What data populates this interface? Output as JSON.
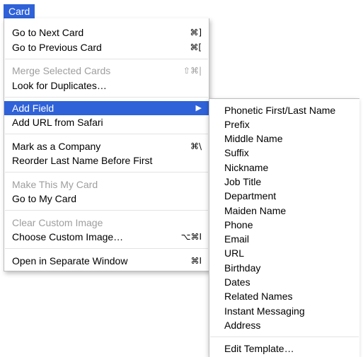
{
  "menubar": {
    "title": "Card"
  },
  "card_menu": {
    "items": [
      {
        "label": "Go to Next Card",
        "shortcut": "⌘]"
      },
      {
        "label": "Go to Previous Card",
        "shortcut": "⌘["
      },
      {
        "label": "Merge Selected Cards",
        "shortcut": "⇧⌘|",
        "disabled": true
      },
      {
        "label": "Look for Duplicates…",
        "shortcut": ""
      },
      {
        "label": "Add Field",
        "submenu": true,
        "selected": true
      },
      {
        "label": "Add URL from Safari",
        "shortcut": ""
      },
      {
        "label": "Mark as a Company",
        "shortcut": "⌘\\"
      },
      {
        "label": "Reorder Last Name Before First",
        "shortcut": ""
      },
      {
        "label": "Make This My Card",
        "shortcut": "",
        "disabled": true
      },
      {
        "label": "Go to My Card",
        "shortcut": ""
      },
      {
        "label": "Clear Custom Image",
        "shortcut": "",
        "disabled": true
      },
      {
        "label": "Choose Custom Image…",
        "shortcut": "⌥⌘I"
      },
      {
        "label": "Open in Separate Window",
        "shortcut": "⌘I"
      }
    ],
    "submenu_arrow": "▶"
  },
  "add_field_submenu": {
    "items": [
      "Phonetic First/Last Name",
      "Prefix",
      "Middle Name",
      "Suffix",
      "Nickname",
      "Job Title",
      "Department",
      "Maiden Name",
      "Phone",
      "Email",
      "URL",
      "Birthday",
      "Dates",
      "Related Names",
      "Instant Messaging",
      "Address"
    ],
    "edit_template": "Edit Template…"
  },
  "colors": {
    "highlight": "#2f62d9",
    "disabled_text": "#9e9e9e"
  }
}
